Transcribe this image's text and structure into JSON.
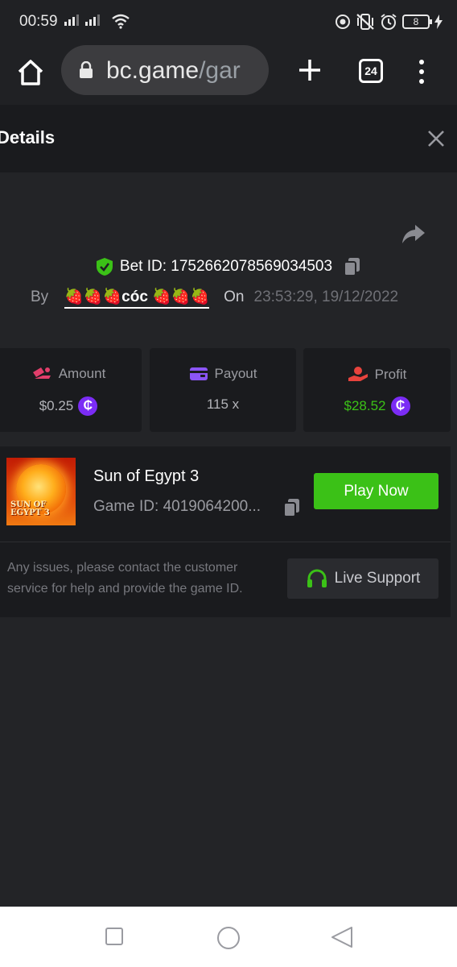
{
  "status_bar": {
    "time": "00:59",
    "battery": "8",
    "icons": [
      "signal-icon",
      "signal-icon",
      "wifi-icon",
      "screen-record-icon",
      "vibrate-off-icon",
      "alarm-icon",
      "battery-icon",
      "charging-icon"
    ]
  },
  "browser": {
    "url_host": "bc.game",
    "url_path": "/gar",
    "tab_count": "24"
  },
  "dialog": {
    "title": "Details",
    "bet_label": "Bet ID: 1752662078569034503",
    "by_label": "By",
    "username": "🍓🍓🍓cóc 🍓🍓🍓",
    "on_label": "On",
    "datetime": "23:53:29, 19/12/2022"
  },
  "stats": [
    {
      "label": "Amount",
      "value": "$0.25",
      "coin": "₵",
      "icon": "amount-icon"
    },
    {
      "label": "Payout",
      "value": "115 x",
      "icon": "wallet-icon"
    },
    {
      "label": "Profit",
      "value": "$28.52",
      "coin": "₵",
      "icon": "profit-icon"
    }
  ],
  "game": {
    "name": "Sun of Egypt 3",
    "game_id": "Game ID: 4019064200...",
    "thumb_line1": "SUN OF",
    "thumb_line2": "EGYPT 3",
    "play_label": "Play Now"
  },
  "support": {
    "notice": "Any issues, please contact the customer service for help and provide the game ID.",
    "button_label": "Live Support"
  },
  "colors": {
    "accent_green": "#3bc117",
    "profit_green": "#3bc117",
    "coin_purple": "#7b2cf5",
    "amount_pink": "#e23e6b",
    "payout_purple": "#8b55f5",
    "profit_red": "#e8433d"
  }
}
